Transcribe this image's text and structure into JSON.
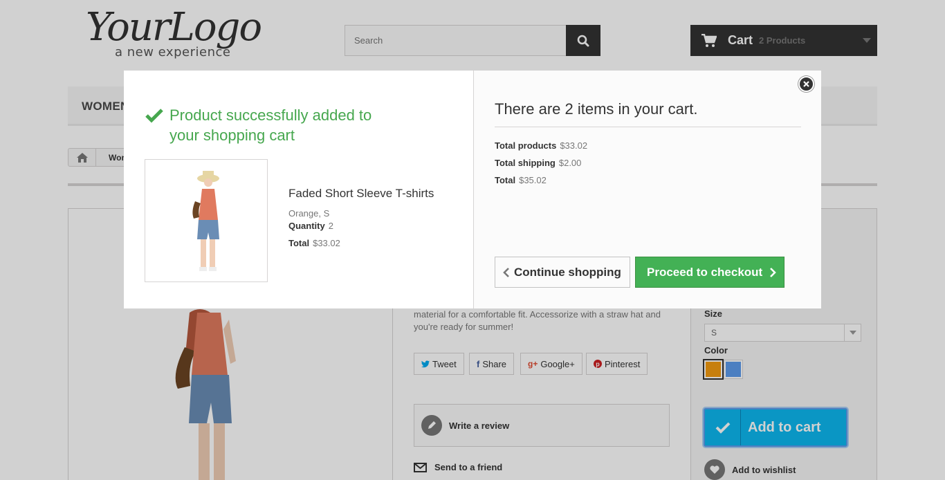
{
  "header": {
    "logo_main": "YourLogo",
    "logo_tagline": "a new experience",
    "search_placeholder": "Search",
    "cart_label": "Cart",
    "cart_count": "2 Products"
  },
  "menu": {
    "women": "WOMEN"
  },
  "breadcrumb": {
    "item": "Wom"
  },
  "product_page": {
    "description": "material for a comfortable fit. Accessorize with a straw hat and you're ready for summer!",
    "social": [
      "Tweet",
      "Share",
      "Google+",
      "Pinterest"
    ],
    "write_review": "Write a review",
    "send_friend": "Send to a friend",
    "size_label": "Size",
    "size_value": "S",
    "color_label": "Color",
    "colors": [
      "#f39c11",
      "#5d9cec"
    ],
    "add_to_cart": "Add to cart",
    "add_to_wishlist": "Add to wishlist"
  },
  "modal": {
    "success_message": "Product successfully added to your shopping cart",
    "product_name": "Faded Short Sleeve T-shirts",
    "attributes": "Orange, S",
    "quantity_label": "Quantity",
    "quantity_value": "2",
    "total_label": "Total",
    "total_value": "$33.02",
    "cart_heading": "There are 2 items in your cart.",
    "total_products_label": "Total products",
    "total_products_value": "$33.02",
    "total_shipping_label": "Total shipping",
    "total_shipping_value": "$2.00",
    "grand_total_label": "Total",
    "grand_total_value": "$35.02",
    "continue_shopping": "Continue shopping",
    "proceed_checkout": "Proceed to checkout"
  },
  "colors": {
    "success_green": "#46a74e",
    "checkout_green": "#43b155",
    "add_to_cart_blue": "#0db7ef",
    "dark": "#333333"
  }
}
